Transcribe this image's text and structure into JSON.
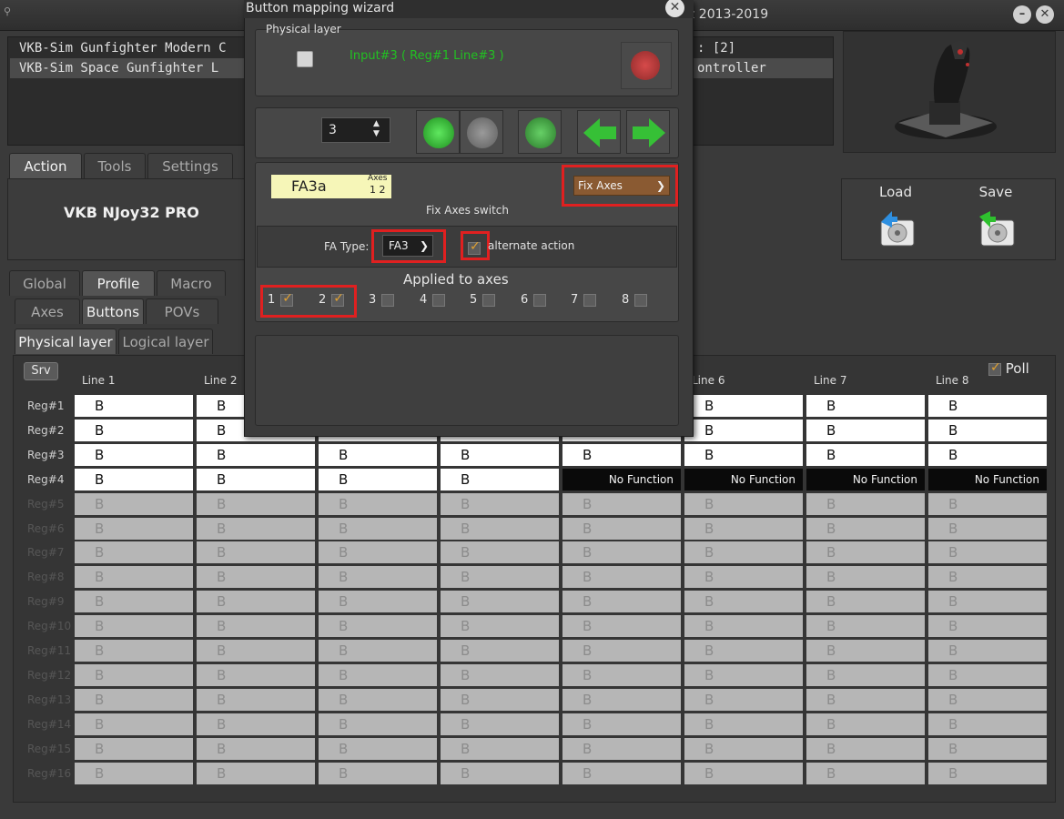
{
  "window": {
    "title": "z 2013-2019",
    "minimize_glyph": "–",
    "close_glyph": "✕"
  },
  "devices": [
    {
      "name": "VKB-Sim Gunfighter Modern C",
      "right": ": [2]"
    },
    {
      "name": "VKB-Sim Space Gunfighter L",
      "right": "ontroller"
    }
  ],
  "main_tabs": [
    "Action",
    "Tools",
    "Settings"
  ],
  "device_name": "VKB NJoy32 PRO",
  "load_label": "Load",
  "save_label": "Save",
  "sub_tabs": [
    "Global",
    "Profile",
    "Macro"
  ],
  "button_tabs": [
    "Axes",
    "Buttons",
    "POVs"
  ],
  "layer_tabs": [
    "Physical layer",
    "Logical layer"
  ],
  "grid": {
    "srv_label": "Srv",
    "poll_label": "Poll",
    "poll_checked": true,
    "columns": [
      "Line 1",
      "Line 2",
      "",
      "",
      "",
      "Line 6",
      "Line 7",
      "Line 8"
    ],
    "rows": [
      {
        "reg": "Reg#1",
        "cells": [
          "B",
          "B",
          "",
          "",
          "",
          "B",
          "B",
          "B"
        ]
      },
      {
        "reg": "Reg#2",
        "cells": [
          "B",
          "B",
          "",
          "",
          "",
          "B",
          "B",
          "B"
        ]
      },
      {
        "reg": "Reg#3",
        "cells": [
          "B",
          "B",
          "B",
          "B",
          "B",
          "B",
          "B",
          "B"
        ]
      },
      {
        "reg": "Reg#4",
        "cells": [
          "B",
          "B",
          "B",
          "B",
          "No Function",
          "No Function",
          "No Function",
          "No Function"
        ]
      },
      {
        "reg": "Reg#5",
        "cells": [
          "B",
          "B",
          "B",
          "B",
          "B",
          "B",
          "B",
          "B"
        ]
      },
      {
        "reg": "Reg#6",
        "cells": [
          "B",
          "B",
          "B",
          "B",
          "B",
          "B",
          "B",
          "B"
        ]
      },
      {
        "reg": "Reg#7",
        "cells": [
          "B",
          "B",
          "B",
          "B",
          "B",
          "B",
          "B",
          "B"
        ]
      },
      {
        "reg": "Reg#8",
        "cells": [
          "B",
          "B",
          "B",
          "B",
          "B",
          "B",
          "B",
          "B"
        ]
      },
      {
        "reg": "Reg#9",
        "cells": [
          "B",
          "B",
          "B",
          "B",
          "B",
          "B",
          "B",
          "B"
        ]
      },
      {
        "reg": "Reg#10",
        "cells": [
          "B",
          "B",
          "B",
          "B",
          "B",
          "B",
          "B",
          "B"
        ]
      },
      {
        "reg": "Reg#11",
        "cells": [
          "B",
          "B",
          "B",
          "B",
          "B",
          "B",
          "B",
          "B"
        ]
      },
      {
        "reg": "Reg#12",
        "cells": [
          "B",
          "B",
          "B",
          "B",
          "B",
          "B",
          "B",
          "B"
        ]
      },
      {
        "reg": "Reg#13",
        "cells": [
          "B",
          "B",
          "B",
          "B",
          "B",
          "B",
          "B",
          "B"
        ]
      },
      {
        "reg": "Reg#14",
        "cells": [
          "B",
          "B",
          "B",
          "B",
          "B",
          "B",
          "B",
          "B"
        ]
      },
      {
        "reg": "Reg#15",
        "cells": [
          "B",
          "B",
          "B",
          "B",
          "B",
          "B",
          "B",
          "B"
        ]
      },
      {
        "reg": "Reg#16",
        "cells": [
          "B",
          "B",
          "B",
          "B",
          "B",
          "B",
          "B",
          "B"
        ]
      }
    ]
  },
  "dialog": {
    "title": "Button mapping wizard",
    "physical_layer_label": "Physical layer",
    "input_text": "Input#3 ( Reg#1  Line#3 )",
    "spin_value": "3",
    "fa_code": "FA3a",
    "fa_axes_label": "Axes",
    "fa_axes_nums": "1 2",
    "function_select": "Fix Axes",
    "switch_label": "Fix Axes switch",
    "fa_type_label": "FA Type:",
    "fa_type_value": "FA3",
    "alternate_label": "alternate action",
    "alternate_checked": true,
    "applied_label": "Applied to axes",
    "axes": [
      {
        "n": "1",
        "checked": true
      },
      {
        "n": "2",
        "checked": true
      },
      {
        "n": "3",
        "checked": false
      },
      {
        "n": "4",
        "checked": false
      },
      {
        "n": "5",
        "checked": false
      },
      {
        "n": "6",
        "checked": false
      },
      {
        "n": "7",
        "checked": false
      },
      {
        "n": "8",
        "checked": false
      }
    ]
  },
  "icons": {
    "close": "close-icon",
    "copy": "copy-icon",
    "paste": "paste-icon",
    "reset": "reset-icon",
    "prev": "arrow-left-icon",
    "next": "arrow-right-icon",
    "load": "hdd-load-icon",
    "save": "hdd-save-icon"
  },
  "colors": {
    "input_text": "#22c022",
    "highlight_red": "#e02020",
    "fix_axes_select": "#8a5a32",
    "fa_code_bg": "#f6f6b8"
  }
}
